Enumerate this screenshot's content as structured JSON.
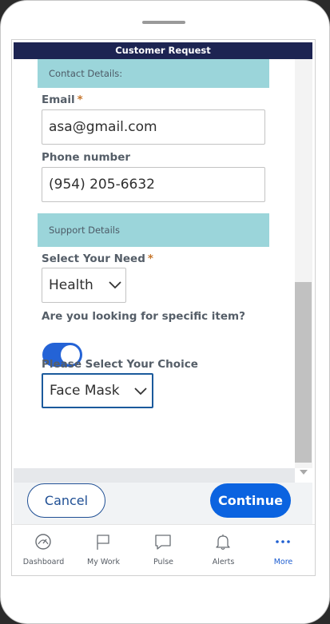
{
  "header": {
    "title": "Customer Request"
  },
  "sections": {
    "contact": "Contact Details:",
    "support": "Support Details"
  },
  "fields": {
    "email": {
      "label": "Email",
      "required": "*",
      "value": "asa@gmail.com"
    },
    "phone": {
      "label": "Phone number",
      "value": "(954) 205-6632"
    },
    "need": {
      "label": "Select Your Need",
      "required": "*",
      "value": "Health"
    },
    "specific_item": {
      "label": "Are you looking for specific item?",
      "on": true
    },
    "choice": {
      "label": "Please Select Your Choice",
      "value": "Face Mask"
    }
  },
  "actions": {
    "cancel": "Cancel",
    "continue": "Continue"
  },
  "nav": {
    "items": [
      {
        "label": "Dashboard",
        "icon": "dashboard-icon"
      },
      {
        "label": "My Work",
        "icon": "flag-icon"
      },
      {
        "label": "Pulse",
        "icon": "chat-icon"
      },
      {
        "label": "Alerts",
        "icon": "bell-icon"
      },
      {
        "label": "More",
        "icon": "more-icon",
        "active": true
      }
    ]
  },
  "colors": {
    "header": "#1d2452",
    "section": "#9bd5da",
    "accent": "#0b63e0",
    "required": "#c6762d"
  }
}
